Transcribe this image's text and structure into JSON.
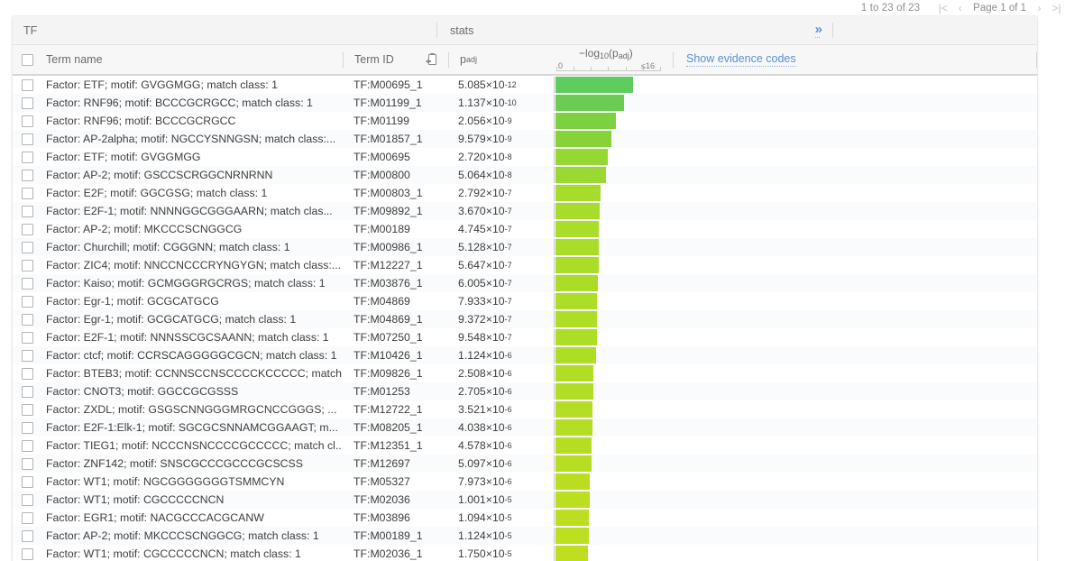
{
  "pagination": {
    "count_label": "1 to 23 of 23",
    "first_label": "|<",
    "prev_label": "‹",
    "page_label": "Page 1 of 1",
    "next_label": "›",
    "last_label": ">|"
  },
  "group_header": {
    "tf_label": "TF",
    "stats_label": "stats",
    "expand_label": "»"
  },
  "columns": {
    "term_name": "Term name",
    "term_id": "Term ID",
    "copy_icon": "clipboard-copy-icon",
    "padj": "p",
    "padj_sub": "adj",
    "axis_title_pre": "−log",
    "axis_title_sub": "10",
    "axis_title_post": "(p",
    "axis_title_sub2": "adj",
    "axis_title_end": ")",
    "axis_min": "0",
    "axis_max": "≤16",
    "evidence_link": "Show evidence codes"
  },
  "colors": {
    "bar_top": "#5fcc5f",
    "bar_bottom": "#bede1f",
    "link": "#5b8fd6",
    "header_bg": "#f4f4f4",
    "row_alt": "#fafbfc"
  },
  "chart_data": {
    "type": "bar",
    "title": "−log10(padj)",
    "xlabel": "−log10(padj)",
    "ylabel": "Term name",
    "xlim": [
      0,
      16
    ],
    "grid": false,
    "legend": "none",
    "categories": [
      "Factor: ETF; motif: GVGGMGG; match class: 1",
      "Factor: RNF96; motif: BCCCGCRGCC; match class: 1",
      "Factor: RNF96; motif: BCCCGCRGCC",
      "Factor: AP-2alpha; motif: NGCCYSNNGSN; match class:...",
      "Factor: ETF; motif: GVGGMGG",
      "Factor: AP-2; motif: GSCCSCRGGCNRNRNN",
      "Factor: E2F; motif: GGCGSG; match class: 1",
      "Factor: E2F-1; motif: NNNNGGCGGGAARN; match clas...",
      "Factor: AP-2; motif: MKCCCSCNGGCG",
      "Factor: Churchill; motif: CGGGNN; match class: 1",
      "Factor: ZIC4; motif: NNCCNCCCRYNGYGN; match class:...",
      "Factor: Kaiso; motif: GCMGGGRGCRGS; match class: 1",
      "Factor: Egr-1; motif: GCGCATGCG",
      "Factor: Egr-1; motif: GCGCATGCG; match class: 1",
      "Factor: E2F-1; motif: NNNSSCGCSAANN; match class: 1",
      "Factor: ctcf; motif: CCRSCAGGGGGCGCN; match class: 1",
      "Factor: BTEB3; motif: CCNNSCCNSCCCCKCCCCC; match...",
      "Factor: CNOT3; motif: GGCCGCGSSS",
      "Factor: ZXDL; motif: GSGSCNNGGGMRGCNCCGGGS; ...",
      "Factor: E2F-1:Elk-1; motif: SGCGCSNNAMCGGAAGT; m...",
      "Factor: TIEG1; motif: NCCCNSNCCCCGCCCCC; match cl...",
      "Factor: ZNF142; motif: SNSCGCCCGCCCGCSCSS",
      "Factor: WT1; motif: NGCGGGGGGGTSMMCYN",
      "Factor: WT1; motif: CGCCCCCNCN",
      "Factor: EGR1; motif: NACGCCCACGCANW",
      "Factor: AP-2; motif: MKCCCSCNGGCG; match class: 1",
      "Factor: WT1; motif: CGCCCCCNCN; match class: 1"
    ],
    "values": [
      11.29,
      9.94,
      8.69,
      8.02,
      7.57,
      7.3,
      6.55,
      6.44,
      6.32,
      6.29,
      6.25,
      6.22,
      6.1,
      6.03,
      6.02,
      5.95,
      5.6,
      5.57,
      5.45,
      5.39,
      5.34,
      5.29,
      5.1,
      5.0,
      4.96,
      4.95,
      4.76
    ]
  },
  "rows": [
    {
      "term": "Factor: ETF; motif: GVGGMGG; match class: 1",
      "id": "TF:M00695_1",
      "mant": "5.085×10",
      "exp": "-12",
      "bar": 86,
      "color": "#5fcc5f"
    },
    {
      "term": "Factor: RNF96; motif: BCCCGCRGCC; match class: 1",
      "id": "TF:M01199_1",
      "mant": "1.137×10",
      "exp": "-10",
      "bar": 76,
      "color": "#6bcb52"
    },
    {
      "term": "Factor: RNF96; motif: BCCCGCRGCC",
      "id": "TF:M01199",
      "mant": "2.056×10",
      "exp": "-9",
      "bar": 67,
      "color": "#7ed13e"
    },
    {
      "term": "Factor: AP-2alpha; motif: NGCCYSNNGSN; match class:...",
      "id": "TF:M01857_1",
      "mant": "9.579×10",
      "exp": "-9",
      "bar": 62,
      "color": "#85d338"
    },
    {
      "term": "Factor: ETF; motif: GVGGMGG",
      "id": "TF:M00695",
      "mant": "2.720×10",
      "exp": "-8",
      "bar": 58,
      "color": "#95d834"
    },
    {
      "term": "Factor: AP-2; motif: GSCCSCRGGCNRNRNN",
      "id": "TF:M00800",
      "mant": "5.064×10",
      "exp": "-8",
      "bar": 56,
      "color": "#99d932"
    },
    {
      "term": "Factor: E2F; motif: GGCGSG; match class: 1",
      "id": "TF:M00803_1",
      "mant": "2.792×10",
      "exp": "-7",
      "bar": 50,
      "color": "#a6dc2b"
    },
    {
      "term": "Factor: E2F-1; motif: NNNNGGCGGGAARN; match clas...",
      "id": "TF:M09892_1",
      "mant": "3.670×10",
      "exp": "-7",
      "bar": 49,
      "color": "#a8dc2a"
    },
    {
      "term": "Factor: AP-2; motif: MKCCCSCNGGCG",
      "id": "TF:M00189",
      "mant": "4.745×10",
      "exp": "-7",
      "bar": 48,
      "color": "#a9dd29"
    },
    {
      "term": "Factor: Churchill; motif: CGGGNN; match class: 1",
      "id": "TF:M00986_1",
      "mant": "5.128×10",
      "exp": "-7",
      "bar": 48,
      "color": "#aadd29"
    },
    {
      "term": "Factor: ZIC4; motif: NNCCNCCCRYNGYGN; match class:...",
      "id": "TF:M12227_1",
      "mant": "5.647×10",
      "exp": "-7",
      "bar": 48,
      "color": "#aadd28"
    },
    {
      "term": "Factor: Kaiso; motif: GCMGGGRGCRGS; match class: 1",
      "id": "TF:M03876_1",
      "mant": "6.005×10",
      "exp": "-7",
      "bar": 47,
      "color": "#abdd28"
    },
    {
      "term": "Factor: Egr-1; motif: GCGCATGCG",
      "id": "TF:M04869",
      "mant": "7.933×10",
      "exp": "-7",
      "bar": 46,
      "color": "#acdd27"
    },
    {
      "term": "Factor: Egr-1; motif: GCGCATGCG; match class: 1",
      "id": "TF:M04869_1",
      "mant": "9.372×10",
      "exp": "-7",
      "bar": 46,
      "color": "#acde27"
    },
    {
      "term": "Factor: E2F-1; motif: NNNSSCGCSAANN; match class: 1",
      "id": "TF:M07250_1",
      "mant": "9.548×10",
      "exp": "-7",
      "bar": 46,
      "color": "#addE27"
    },
    {
      "term": "Factor: ctcf; motif: CCRSCAGGGGGCGCN; match class: 1",
      "id": "TF:M10426_1",
      "mant": "1.124×10",
      "exp": "-6",
      "bar": 45,
      "color": "#addE26"
    },
    {
      "term": "Factor: BTEB3; motif: CCNNSCCNSCCCCKCCCCC; match...",
      "id": "TF:M09826_1",
      "mant": "2.508×10",
      "exp": "-6",
      "bar": 42,
      "color": "#b0de25"
    },
    {
      "term": "Factor: CNOT3; motif: GGCCGCGSSS",
      "id": "TF:M01253",
      "mant": "2.705×10",
      "exp": "-6",
      "bar": 42,
      "color": "#b1de24"
    },
    {
      "term": "Factor: ZXDL; motif: GSGSCNNGGGMRGCNCCGGGS; ...",
      "id": "TF:M12722_1",
      "mant": "3.521×10",
      "exp": "-6",
      "bar": 41,
      "color": "#b3de23"
    },
    {
      "term": "Factor: E2F-1:Elk-1; motif: SGCGCSNNAMCGGAAGT; m...",
      "id": "TF:M08205_1",
      "mant": "4.038×10",
      "exp": "-6",
      "bar": 41,
      "color": "#b4de23"
    },
    {
      "term": "Factor: TIEG1; motif: NCCCNSNCCCCGCCCCC; match cl...",
      "id": "TF:M12351_1",
      "mant": "4.578×10",
      "exp": "-6",
      "bar": 40,
      "color": "#b5de22"
    },
    {
      "term": "Factor: ZNF142; motif: SNSCGCCCGCCCGCSCSS",
      "id": "TF:M12697",
      "mant": "5.097×10",
      "exp": "-6",
      "bar": 40,
      "color": "#b6de22"
    },
    {
      "term": "Factor: WT1; motif: NGCGGGGGGGTSMMCYN",
      "id": "TF:M05327",
      "mant": "7.973×10",
      "exp": "-6",
      "bar": 38,
      "color": "#b9de21"
    },
    {
      "term": "Factor: WT1; motif: CGCCCCCNCN",
      "id": "TF:M02036",
      "mant": "1.001×10",
      "exp": "-5",
      "bar": 38,
      "color": "#badf20"
    },
    {
      "term": "Factor: EGR1; motif: NACGCCCACGCANW",
      "id": "TF:M03896",
      "mant": "1.094×10",
      "exp": "-5",
      "bar": 37,
      "color": "#bbdf20"
    },
    {
      "term": "Factor: AP-2; motif: MKCCCSCNGGCG; match class: 1",
      "id": "TF:M00189_1",
      "mant": "1.124×10",
      "exp": "-5",
      "bar": 37,
      "color": "#bcdf20"
    },
    {
      "term": "Factor: WT1; motif: CGCCCCCNCN; match class: 1",
      "id": "TF:M02036_1",
      "mant": "1.750×10",
      "exp": "-5",
      "bar": 36,
      "color": "#bede1f"
    }
  ]
}
